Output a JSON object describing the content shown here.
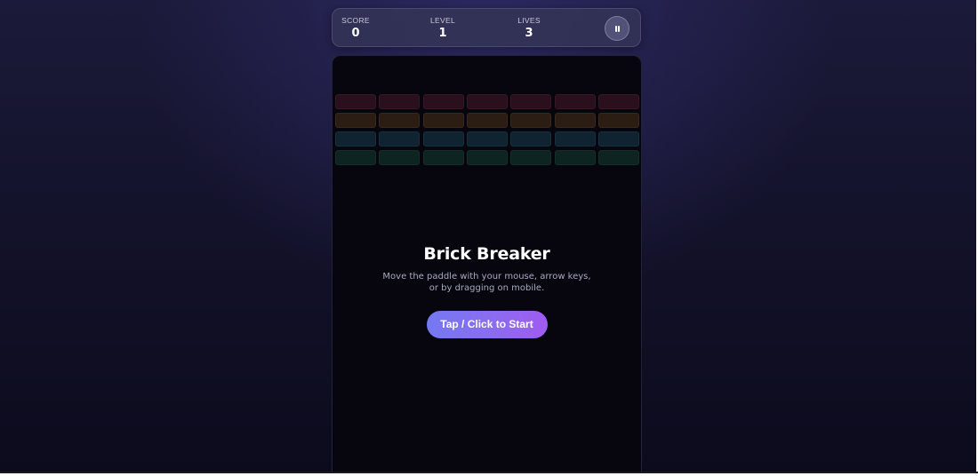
{
  "hud": {
    "score_label": "SCORE",
    "score_value": "0",
    "level_label": "LEVEL",
    "level_value": "1",
    "lives_label": "LIVES",
    "lives_value": "3",
    "pause_icon": "pause-icon"
  },
  "overlay": {
    "title": "Brick Breaker",
    "instructions_line1": "Move the paddle with your mouse, arrow keys,",
    "instructions_line2": "or by dragging on mobile.",
    "start_label": "Tap / Click to Start"
  },
  "bricks": {
    "columns": 7,
    "rows": [
      {
        "color": "#2a0f1d",
        "border": "#3a1526"
      },
      {
        "color": "#2b1d14",
        "border": "#3a2819"
      },
      {
        "color": "#0f2430",
        "border": "#16303d"
      },
      {
        "color": "#0d2420",
        "border": "#132f2a"
      }
    ]
  },
  "colors": {
    "accent_start": "#7479f2",
    "accent_end": "#a05bf0",
    "board_bg": "#07060f"
  }
}
